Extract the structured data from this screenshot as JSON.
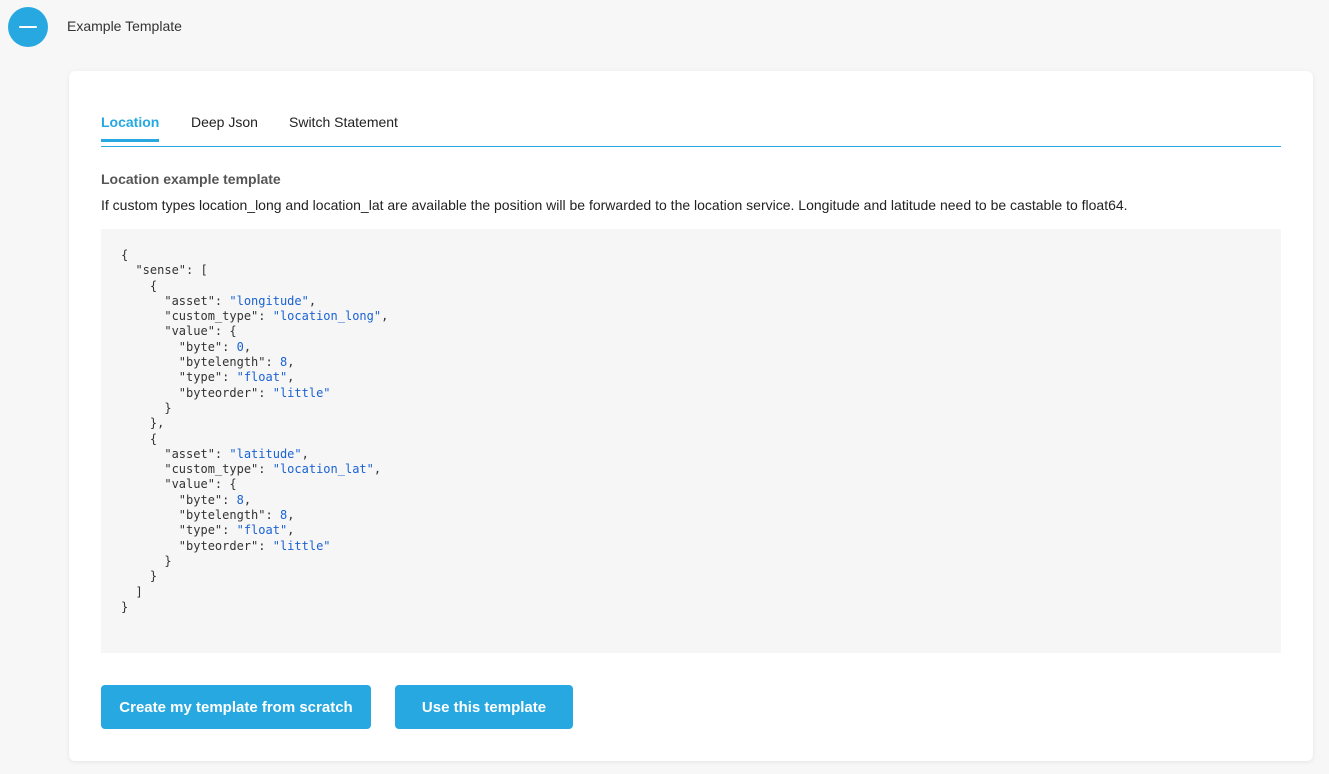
{
  "header": {
    "title": "Example Template",
    "collapse_icon": "minus-icon"
  },
  "tabs": [
    {
      "label": "Location",
      "active": true
    },
    {
      "label": "Deep Json",
      "active": false
    },
    {
      "label": "Switch Statement",
      "active": false
    }
  ],
  "section": {
    "title": "Location example template",
    "description": "If custom types location_long and location_lat are available the position will be forwarded to the location service. Longitude and latitude need to be castable to float64."
  },
  "code": {
    "lines": [
      "{",
      "  \"sense\": [",
      "    {",
      "      \"asset\": \"longitude\",",
      "      \"custom_type\": \"location_long\",",
      "      \"value\": {",
      "        \"byte\": 0,",
      "        \"bytelength\": 8,",
      "        \"type\": \"float\",",
      "        \"byteorder\": \"little\"",
      "      }",
      "    },",
      "    {",
      "      \"asset\": \"latitude\",",
      "      \"custom_type\": \"location_lat\",",
      "      \"value\": {",
      "        \"byte\": 8,",
      "        \"bytelength\": 8,",
      "        \"type\": \"float\",",
      "        \"byteorder\": \"little\"",
      "      }",
      "    }",
      "  ]",
      "}"
    ]
  },
  "buttons": {
    "scratch_label": "Create my template from scratch",
    "use_label": "Use this template"
  },
  "colors": {
    "accent": "#27a8e0",
    "code_value": "#1a62d4"
  }
}
